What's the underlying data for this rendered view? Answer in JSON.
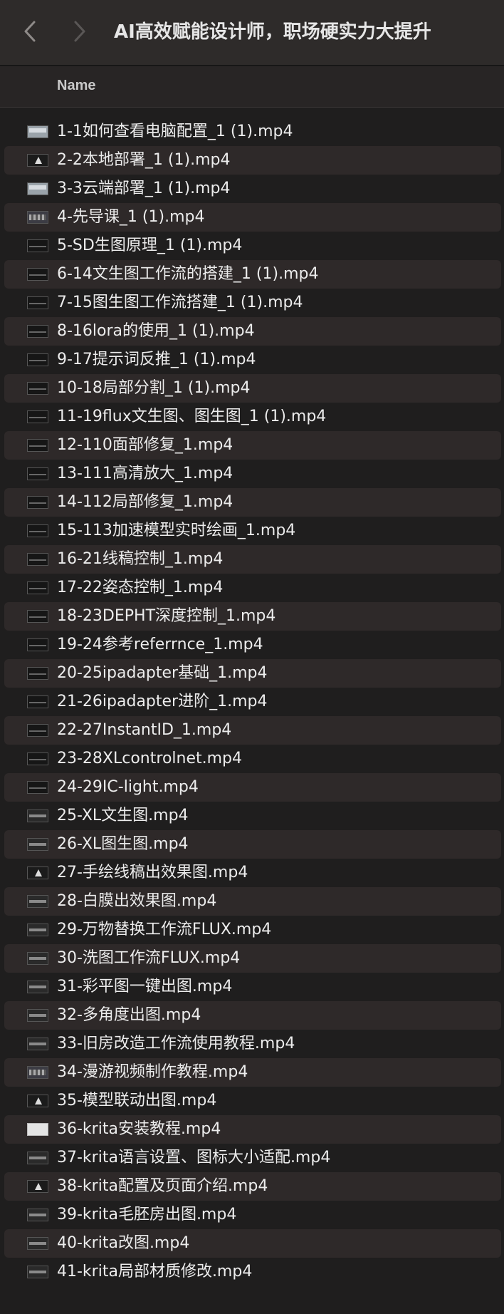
{
  "window": {
    "title": "AI高效赋能设计师，职场硬实力大提升"
  },
  "nav": {
    "back_icon": "chevron-left-icon",
    "forward_icon": "chevron-right-icon"
  },
  "header": {
    "name_column": "Name"
  },
  "files": [
    {
      "name": "1-1如何查看电脑配置_1 (1).mp4",
      "thumb": "light"
    },
    {
      "name": "2-2本地部署_1 (1).mp4",
      "thumb": "tri"
    },
    {
      "name": "3-3云端部署_1 (1).mp4",
      "thumb": "light"
    },
    {
      "name": "4-先导课_1 (1).mp4",
      "thumb": "grid"
    },
    {
      "name": "5-SD生图原理_1 (1).mp4",
      "thumb": "dark"
    },
    {
      "name": "6-14文生图工作流的搭建_1 (1).mp4",
      "thumb": "dark"
    },
    {
      "name": "7-15图生图工作流搭建_1 (1).mp4",
      "thumb": "dark"
    },
    {
      "name": "8-16lora的使用_1 (1).mp4",
      "thumb": "dark"
    },
    {
      "name": "9-17提示词反推_1 (1).mp4",
      "thumb": "dark"
    },
    {
      "name": "10-18局部分割_1 (1).mp4",
      "thumb": "dark"
    },
    {
      "name": "11-19flux文生图、图生图_1 (1).mp4",
      "thumb": "dark"
    },
    {
      "name": "12-110面部修复_1.mp4",
      "thumb": "dark"
    },
    {
      "name": "13-111高清放大_1.mp4",
      "thumb": "dark"
    },
    {
      "name": "14-112局部修复_1.mp4",
      "thumb": "dark"
    },
    {
      "name": "15-113加速模型实时绘画_1.mp4",
      "thumb": "dark"
    },
    {
      "name": "16-21线稿控制_1.mp4",
      "thumb": "dark"
    },
    {
      "name": "17-22姿态控制_1.mp4",
      "thumb": "dark"
    },
    {
      "name": "18-23DEPHT深度控制_1.mp4",
      "thumb": "dark"
    },
    {
      "name": "19-24参考referrnce_1.mp4",
      "thumb": "dark"
    },
    {
      "name": "20-25ipadapter基础_1.mp4",
      "thumb": "dark"
    },
    {
      "name": "21-26ipadapter进阶_1.mp4",
      "thumb": "dark"
    },
    {
      "name": "22-27InstantID_1.mp4",
      "thumb": "dark"
    },
    {
      "name": "23-28XLcontrolnet.mp4",
      "thumb": "dark"
    },
    {
      "name": "24-29IC-light.mp4",
      "thumb": "dark"
    },
    {
      "name": "25-XL文生图.mp4",
      "thumb": "plain"
    },
    {
      "name": "26-XL图生图.mp4",
      "thumb": "plain"
    },
    {
      "name": "27-手绘线稿出效果图.mp4",
      "thumb": "tri"
    },
    {
      "name": "28-白膜出效果图.mp4",
      "thumb": "plain"
    },
    {
      "name": "29-万物替换工作流FLUX.mp4",
      "thumb": "plain"
    },
    {
      "name": "30-洗图工作流FLUX.mp4",
      "thumb": "plain"
    },
    {
      "name": "31-彩平图一键出图.mp4",
      "thumb": "plain"
    },
    {
      "name": "32-多角度出图.mp4",
      "thumb": "plain"
    },
    {
      "name": "33-旧房改造工作流使用教程.mp4",
      "thumb": "plain"
    },
    {
      "name": "34-漫游视频制作教程.mp4",
      "thumb": "grid"
    },
    {
      "name": "35-模型联动出图.mp4",
      "thumb": "tri"
    },
    {
      "name": "36-krita安装教程.mp4",
      "thumb": "white"
    },
    {
      "name": "37-krita语言设置、图标大小适配.mp4",
      "thumb": "plain"
    },
    {
      "name": "38-krita配置及页面介绍.mp4",
      "thumb": "tri"
    },
    {
      "name": "39-krita毛胚房出图.mp4",
      "thumb": "plain"
    },
    {
      "name": "40-krita改图.mp4",
      "thumb": "plain"
    },
    {
      "name": "41-krita局部材质修改.mp4",
      "thumb": "plain"
    }
  ]
}
